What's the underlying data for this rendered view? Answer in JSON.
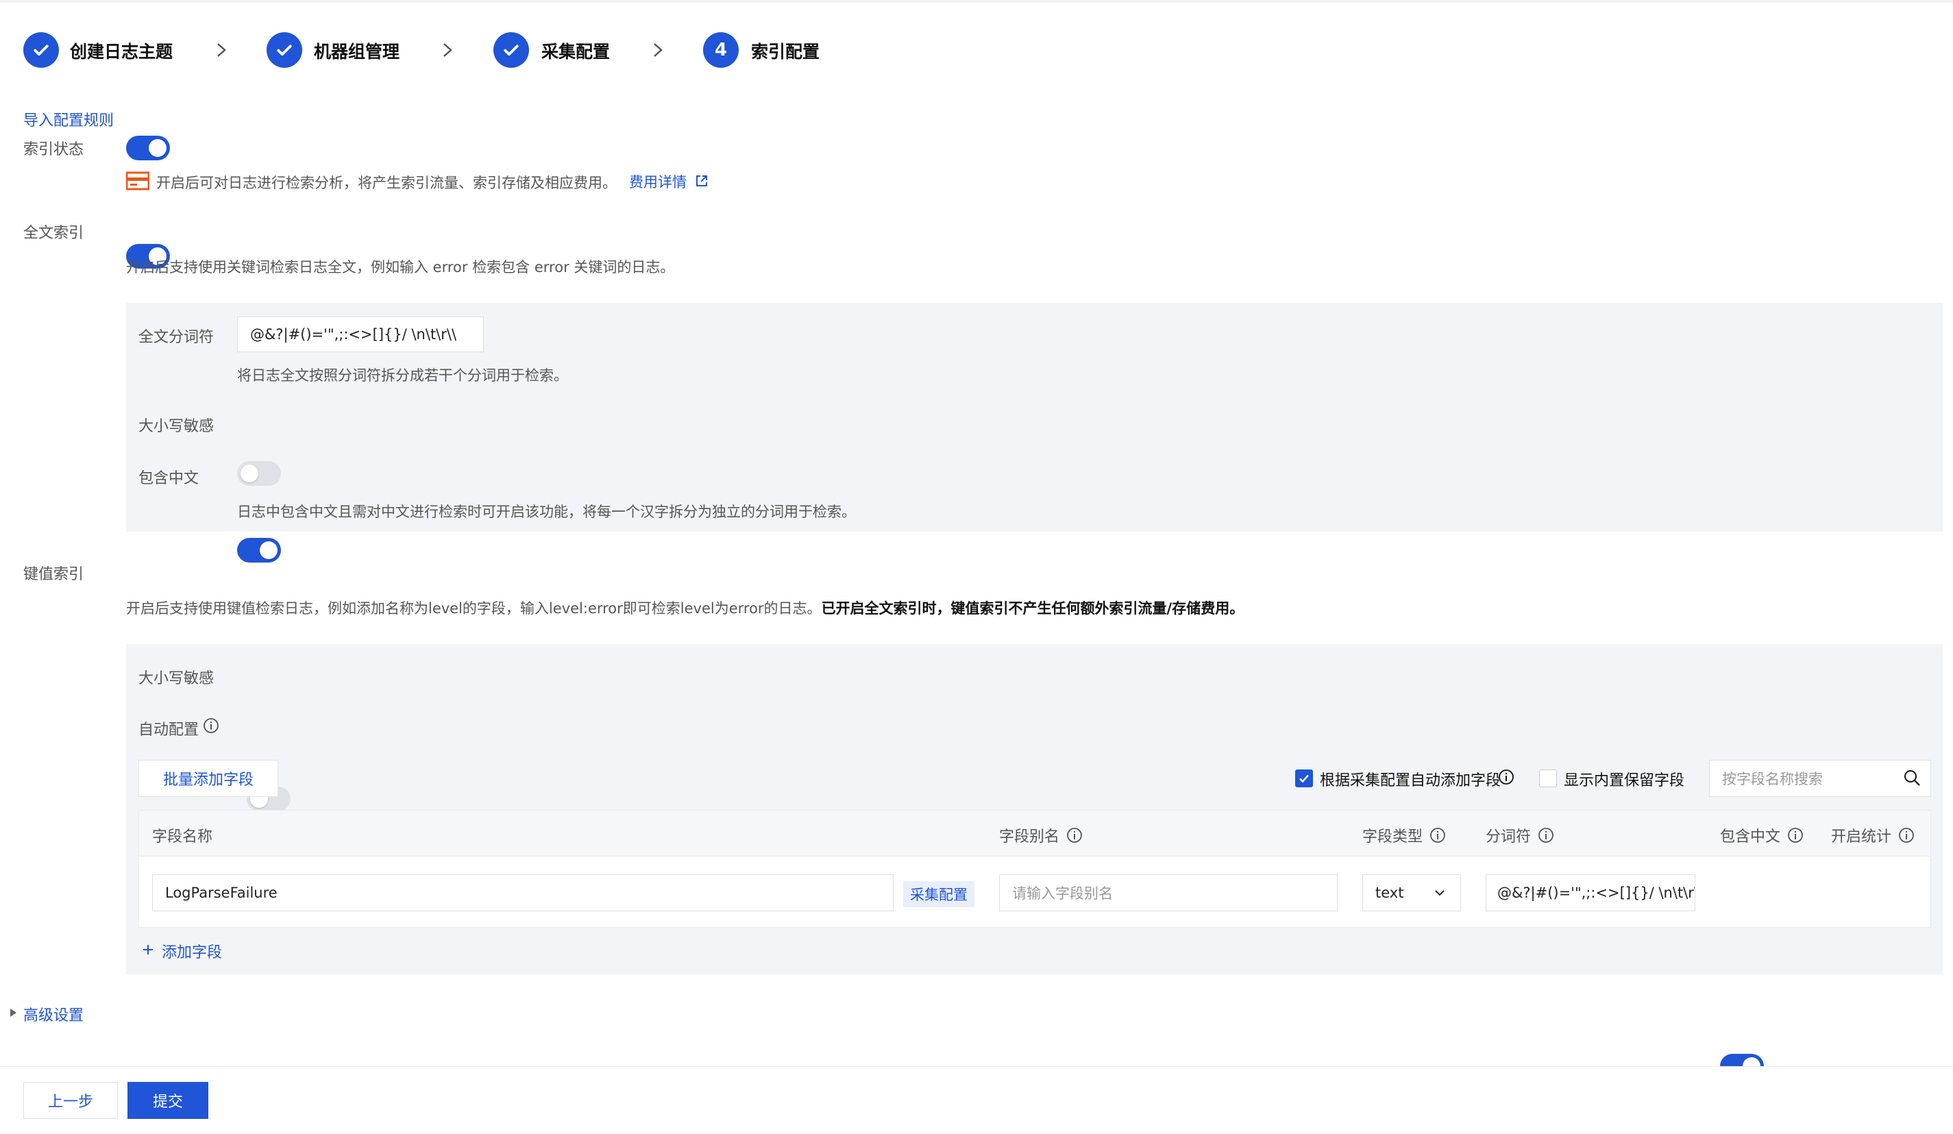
{
  "stepper": [
    {
      "label": "创建日志主题",
      "state": "done"
    },
    {
      "label": "机器组管理",
      "state": "done"
    },
    {
      "label": "采集配置",
      "state": "done"
    },
    {
      "label": "索引配置",
      "state": "current",
      "number": "4"
    }
  ],
  "import_link": "导入配置规则",
  "index_status": {
    "label": "索引状态",
    "enabled": true,
    "notice": "开启后可对日志进行检索分析，将产生索引流量、索引存储及相应费用。",
    "fee_link": "费用详情"
  },
  "full_text": {
    "label": "全文索引",
    "enabled": true,
    "desc": "开启后支持使用关键词检索日志全文，例如输入 error 检索包含 error 关键词的日志。",
    "tokenizer_label": "全文分词符",
    "tokenizer_value": "@&?|#()='\",;:<>[]{}/ \\n\\t\\r\\\\",
    "tokenizer_desc": "将日志全文按照分词符拆分成若干个分词用于检索。",
    "case_label": "大小写敏感",
    "case_enabled": false,
    "chinese_label": "包含中文",
    "chinese_enabled": true,
    "chinese_desc": "日志中包含中文且需对中文进行检索时可开启该功能，将每一个汉字拆分为独立的分词用于检索。"
  },
  "kv": {
    "label": "键值索引",
    "enabled": true,
    "desc": "开启后支持使用键值检索日志，例如添加名称为level的字段，输入level:error即可检索level为error的日志。",
    "desc_bold": "已开启全文索引时，键值索引不产生任何额外索引流量/存储费用。",
    "case_label": "大小写敏感",
    "case_enabled": false,
    "auto_label": "自动配置",
    "auto_enabled": false,
    "batch_add": "批量添加字段",
    "auto_add_label": "根据采集配置自动添加字段",
    "auto_add_checked": true,
    "show_reserved_label": "显示内置保留字段",
    "show_reserved_checked": false,
    "search_placeholder": "按字段名称搜索",
    "columns": {
      "name": "字段名称",
      "alias": "字段别名",
      "type": "字段类型",
      "tokenizer": "分词符",
      "chinese": "包含中文",
      "stats": "开启统计"
    },
    "rows": [
      {
        "name": "LogParseFailure",
        "source_tag": "采集配置",
        "alias_placeholder": "请输入字段别名",
        "type": "text",
        "tokenizer": "@&?|#()='\",;:<>[]{}/ \\n\\t\\r\\\\",
        "chinese": true,
        "stats": true
      }
    ],
    "add_field": "添加字段"
  },
  "advanced": "高级设置",
  "footer": {
    "prev": "上一步",
    "submit": "提交"
  },
  "colors": {
    "primary": "#1f55d6",
    "panel": "#f3f4f7",
    "toggle_off": "#dfe1e6",
    "warning": "#e8581c"
  }
}
